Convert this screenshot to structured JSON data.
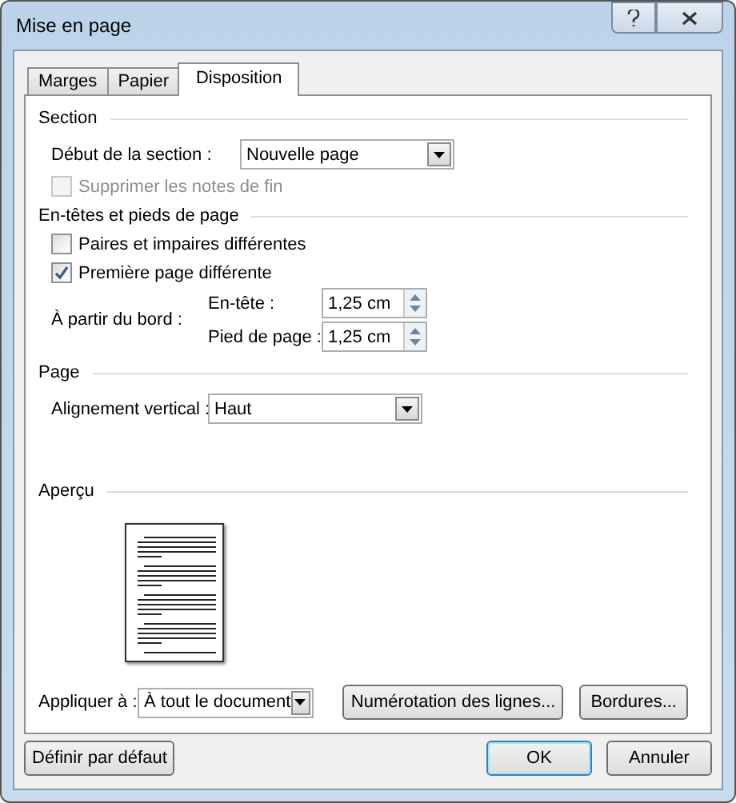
{
  "window": {
    "title": "Mise en page"
  },
  "tabs": [
    {
      "label": "Marges",
      "selected": false
    },
    {
      "label": "Papier",
      "selected": false
    },
    {
      "label": "Disposition",
      "selected": true
    }
  ],
  "section": {
    "title": "Section",
    "start_label": "Début de la section :",
    "start_value": "Nouvelle page",
    "suppress_endnotes": {
      "label": "Supprimer les notes de fin",
      "checked": false,
      "disabled": true
    }
  },
  "headers_footers": {
    "title": "En-têtes et pieds de page",
    "checkboxes": [
      {
        "label": "Paires et impaires différentes",
        "checked": false,
        "disabled": false
      },
      {
        "label": "Première page différente",
        "checked": true,
        "disabled": false
      }
    ],
    "from_edge_label": "À partir du bord :",
    "spinners": [
      {
        "label": "En-tête :",
        "value": "1,25 cm"
      },
      {
        "label": "Pied de page :",
        "value": "1,25 cm"
      }
    ]
  },
  "page": {
    "title": "Page",
    "alignment_label": "Alignement vertical :",
    "alignment_value": "Haut"
  },
  "preview": {
    "title": "Aperçu",
    "apply_label": "Appliquer à :",
    "apply_value": "À tout le document",
    "buttons": [
      "Numérotation des lignes...",
      "Bordures..."
    ]
  },
  "footer": {
    "default_button": "Définir par défaut",
    "buttons": [
      {
        "label": "OK",
        "kind": "default"
      },
      {
        "label": "Annuler",
        "kind": "normal"
      }
    ]
  }
}
